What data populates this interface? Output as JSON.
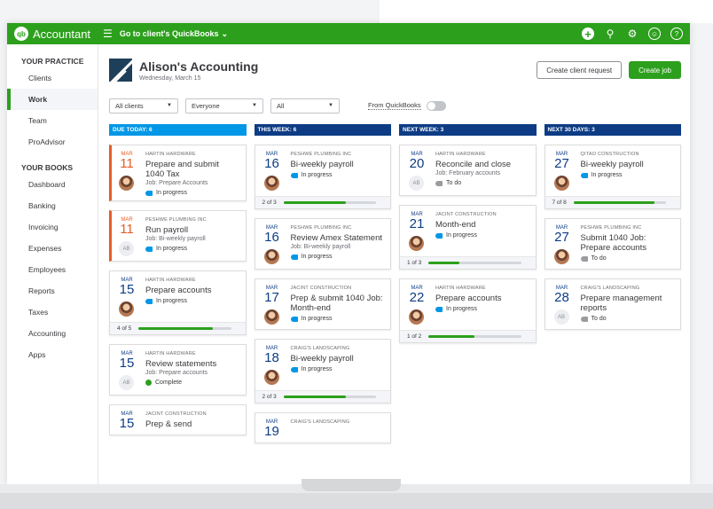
{
  "app": {
    "logo_text": "Accountant",
    "logo_badge": "qb",
    "goto_label": "Go to client's QuickBooks",
    "icons": [
      "plus-icon",
      "search-icon",
      "gear-icon",
      "help-icon"
    ]
  },
  "sidebar": {
    "practice_heading": "YOUR PRACTICE",
    "practice_items": [
      "Clients",
      "Work",
      "Team",
      "ProAdvisor"
    ],
    "active_item": "Work",
    "books_heading": "YOUR BOOKS",
    "books_items": [
      "Dashboard",
      "Banking",
      "Invoicing",
      "Expenses",
      "Employees",
      "Reports",
      "Taxes",
      "Accounting",
      "Apps"
    ]
  },
  "header": {
    "company": "Alison's Accounting",
    "date": "Wednesday, March 15",
    "create_request": "Create client request",
    "create_job": "Create job"
  },
  "filters": {
    "clients": "All clients",
    "assignee": "Everyone",
    "status": "All",
    "from_qb": "From QuickBooks",
    "toggle_on": false
  },
  "colors": {
    "brand": "#2ca01c",
    "today": "#0097e6",
    "week": "#0d3c84",
    "overdue": "#e55d29"
  },
  "columns": [
    {
      "heading": "DUE TODAY: 6",
      "style": "today",
      "cards": [
        {
          "month": "MAR",
          "day": "11",
          "overdue": true,
          "client": "HARTIN HARDWARE",
          "title": "Prepare and submit 1040 Tax",
          "job": "Job: Prepare Accounts",
          "status": "In progress",
          "status_type": "ip",
          "avatar": "photo"
        },
        {
          "month": "MAR",
          "day": "11",
          "overdue": true,
          "client": "PESHWE PLUMBING INC",
          "title": "Run payroll",
          "job": "Job: Bi-weekly payroll",
          "status": "In progress",
          "status_type": "ip",
          "avatar": "AB"
        },
        {
          "month": "MAR",
          "day": "15",
          "client": "HARTIN HARDWARE",
          "title": "Prepare accounts",
          "status": "In progress",
          "status_type": "ip",
          "avatar": "photo",
          "progress": "4 of 5",
          "progress_value": 0.8
        },
        {
          "month": "MAR",
          "day": "15",
          "client": "HARTIN HARDWARE",
          "title": "Review statements",
          "job": "Job: Prepare accounts",
          "status": "Complete",
          "status_type": "done",
          "avatar": "AB"
        },
        {
          "month": "MAR",
          "day": "15",
          "client": "JACINT CONSTRUCTION",
          "title": "Prep & send"
        }
      ]
    },
    {
      "heading": "THIS WEEK: 6",
      "style": "week",
      "cards": [
        {
          "month": "MAR",
          "day": "16",
          "client": "PESHWE PLUMBING INC",
          "title": "Bi-weekly payroll",
          "status": "In progress",
          "status_type": "ip",
          "avatar": "photo",
          "progress": "2 of 3",
          "progress_value": 0.67
        },
        {
          "month": "MAR",
          "day": "16",
          "client": "PESHWE PLUMBING INC",
          "title": "Review Amex Statement",
          "job": "Job: Bi-weekly payroll",
          "status": "In progress",
          "status_type": "ip",
          "avatar": "photo"
        },
        {
          "month": "MAR",
          "day": "17",
          "client": "JACINT CONSTRUCTION",
          "title": "Prep & submit 1040 Job: Month-end",
          "status": "In progress",
          "status_type": "ip",
          "avatar": "photo"
        },
        {
          "month": "MAR",
          "day": "18",
          "client": "CRAIG'S LANDSCAPING",
          "title": "Bi-weekly payroll",
          "status": "In progress",
          "status_type": "ip",
          "avatar": "photo",
          "progress": "2 of 3",
          "progress_value": 0.67
        },
        {
          "month": "MAR",
          "day": "19",
          "client": "CRAIG'S LANDSCAPING",
          "title": ""
        }
      ]
    },
    {
      "heading": "NEXT WEEK: 3",
      "style": "week",
      "cards": [
        {
          "month": "MAR",
          "day": "20",
          "client": "HARTIN HARDWARE",
          "title": "Reconcile and close",
          "job": "Job: February accounts",
          "status": "To do",
          "status_type": "todo",
          "avatar": "AB"
        },
        {
          "month": "MAR",
          "day": "21",
          "client": "JACINT CONSTRUCTION",
          "title": "Month-end",
          "status": "In progress",
          "status_type": "ip",
          "avatar": "photo",
          "progress": "1 of 3",
          "progress_value": 0.33
        },
        {
          "month": "MAR",
          "day": "22",
          "client": "HARTIN HARDWARE",
          "title": "Prepare accounts",
          "status": "In progress",
          "status_type": "ip",
          "avatar": "photo",
          "progress": "1 of 2",
          "progress_value": 0.5
        }
      ]
    },
    {
      "heading": "NEXT 30 DAYS: 3",
      "style": "week",
      "cards": [
        {
          "month": "MAR",
          "day": "27",
          "client": "QITAO CONSTRUCTION",
          "title": "Bi-weekly payroll",
          "status": "In progress",
          "status_type": "ip",
          "avatar": "photo",
          "progress": "7 of 8",
          "progress_value": 0.875
        },
        {
          "month": "MAR",
          "day": "27",
          "client": "PESHWE PLUMBING INC",
          "title": "Submit 1040 Job: Prepare accounts",
          "status": "To do",
          "status_type": "todo",
          "avatar": "photo"
        },
        {
          "month": "MAR",
          "day": "28",
          "client": "CRAIG'S LANDSCAPING",
          "title": "Prepare management reports",
          "status": "To do",
          "status_type": "todo",
          "avatar": "AB"
        }
      ]
    }
  ]
}
